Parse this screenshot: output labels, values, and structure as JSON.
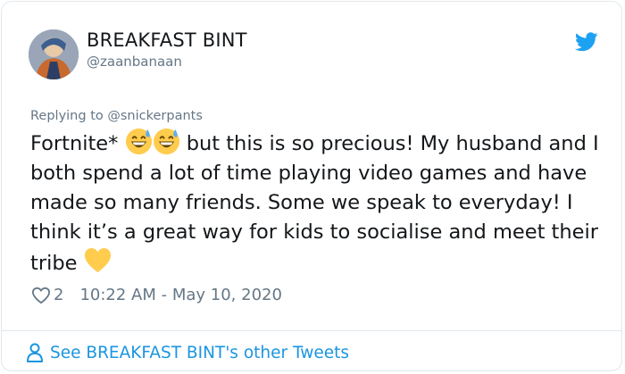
{
  "tweet": {
    "author_name": "BREAKFAST BINT",
    "author_handle": "@zaanbanaan",
    "replying_to": "Replying to @snickerpants",
    "body_part1": "Fortnite*",
    "body_part2": "but this is so precious! My husband and I both spend a lot of time playing video games and have made so many friends. Some we speak to everyday! I think it’s a great way for kids to socialise and meet their tribe",
    "emoji_names": [
      "grinning-sweat-emoji",
      "grinning-sweat-emoji",
      "yellow-heart-emoji"
    ],
    "like_count": "2",
    "timestamp": "10:22 AM - May 10, 2020",
    "footer_link": "See BREAKFAST BINT's other Tweets"
  },
  "colors": {
    "twitter_blue": "#1da1f2",
    "link_blue": "#1b95e0",
    "muted_gray": "#657786",
    "border": "#e1e8ed"
  },
  "icons": [
    "twitter-bird-icon",
    "heart-outline-icon",
    "person-icon"
  ]
}
